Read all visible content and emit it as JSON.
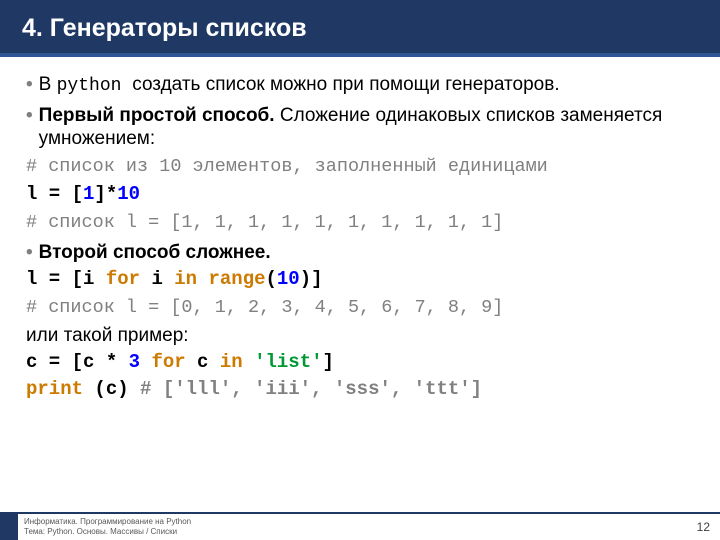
{
  "title": "4. Генераторы списков",
  "p1_a": "В ",
  "p1_b": "python ",
  "p1_c": "создать список можно при помощи генераторов.",
  "p2_a": "Первый простой способ. ",
  "p2_b": "Сложение одинаковых списков заменяется умножением:",
  "c1": "# список из 10 элементов, заполненный единицами",
  "code1_a": "l = [",
  "code1_b": "1",
  "code1_c": "]*",
  "code1_d": "10",
  "c2": "# список l = [1, 1, 1, 1, 1, 1, 1, 1, 1, 1]",
  "p3": "Второй способ сложнее.",
  "code2_a": "l = [i ",
  "code2_for": "for",
  "code2_b": " i ",
  "code2_in": "in",
  "code2_c": " ",
  "code2_range": "range",
  "code2_d": "(",
  "code2_e": "10",
  "code2_f": ")]",
  "c3": "# список l = [0, 1, 2, 3, 4, 5, 6, 7, 8, 9]",
  "p4": "или такой пример:",
  "code3_a": "c = [c * ",
  "code3_b": "3",
  "code3_c": " ",
  "code3_for": "for",
  "code3_d": " c ",
  "code3_in": "in",
  "code3_e": " ",
  "code3_str": "'list'",
  "code3_f": "]",
  "code4_a": "print",
  "code4_b": " (c) ",
  "code4_cmt": "# ['lll', 'iii', 'sss', 'ttt']",
  "footer_line1": "Информатика. Программирование на Python",
  "footer_line2": "Тема: Python. Основы. Массивы / Списки",
  "page_number": "12"
}
